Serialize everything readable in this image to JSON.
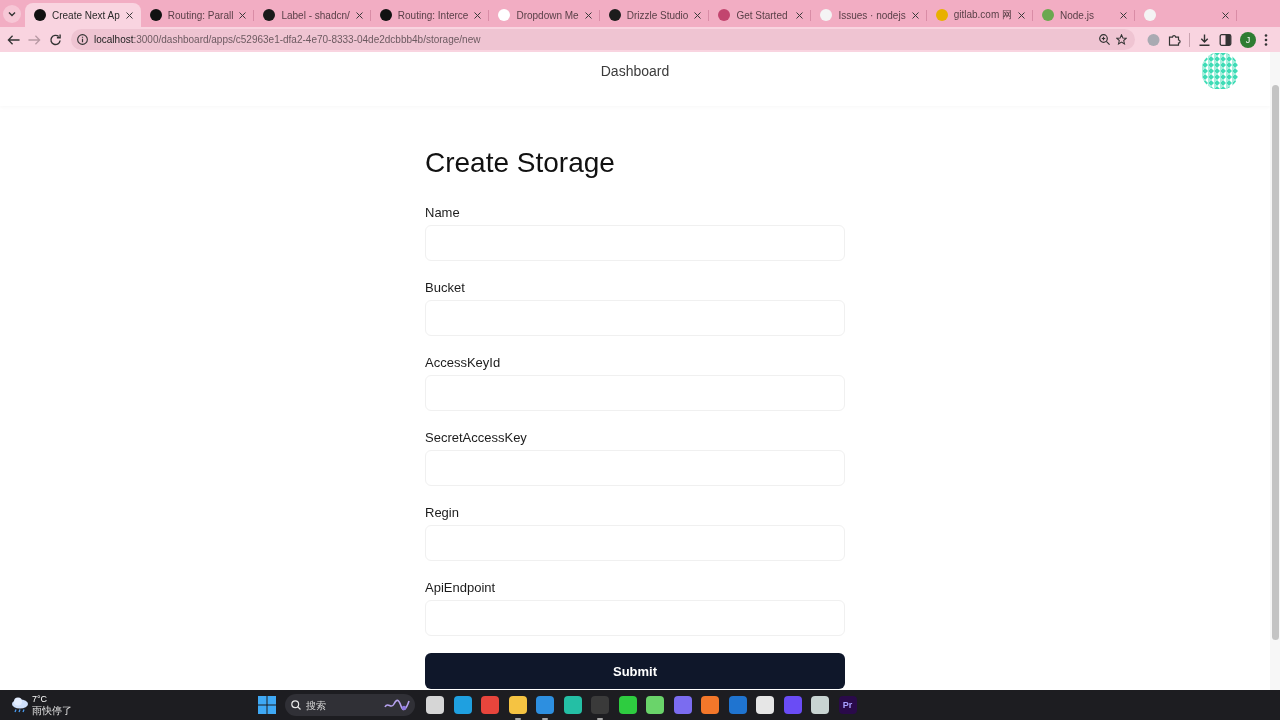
{
  "browser": {
    "tabs": [
      {
        "title": "Create Next Ap",
        "selected": true,
        "color": "#111111"
      },
      {
        "title": "Routing: Parall",
        "selected": false,
        "color": "#111111"
      },
      {
        "title": "Label - shadcn/",
        "selected": false,
        "color": "#1a1a1a"
      },
      {
        "title": "Routing: Interce",
        "selected": false,
        "color": "#111111"
      },
      {
        "title": "Dropdown Me",
        "selected": false,
        "color": "#ffffff"
      },
      {
        "title": "Drizzle Studio",
        "selected": false,
        "color": "#1c1c1c"
      },
      {
        "title": "Get Started",
        "selected": false,
        "color": "#c2456f"
      },
      {
        "title": "Issues · nodejs",
        "selected": false,
        "color": "#f4f4f4"
      },
      {
        "title": "gitlab.com 网",
        "selected": false,
        "color": "#e8b000"
      },
      {
        "title": "Node.js",
        "selected": false,
        "color": "#6aa84f"
      },
      {
        "selected": false,
        "color": "#f4f4f4"
      }
    ],
    "toolbar": {
      "forward_disabled": true,
      "url": {
        "host": "localhost",
        "path": ":3000/dashboard/apps/c52963e1-dfa2-4e70-8333-04de2dcbbb4b/storage/new"
      },
      "profile_initial": "J"
    }
  },
  "page": {
    "header_title": "Dashboard",
    "title": "Create Storage",
    "fields": [
      {
        "label": "Name"
      },
      {
        "label": "Bucket"
      },
      {
        "label": "AccessKeyId"
      },
      {
        "label": "SecretAccessKey"
      },
      {
        "label": "Regin"
      },
      {
        "label": "ApiEndpoint"
      }
    ],
    "submit": "Submit"
  },
  "taskbar": {
    "weather": {
      "temperature": "7°C",
      "condition": "雨快停了"
    },
    "search": {
      "placeholder": "搜索"
    },
    "apps": [
      {
        "color": "#d6d6d6",
        "running": false
      },
      {
        "color": "#1fa0e0",
        "running": false
      },
      {
        "color": "#e8453c",
        "running": false
      },
      {
        "color": "#f5c342",
        "running": true
      },
      {
        "color": "#2d8fe0",
        "running": true
      },
      {
        "color": "#24bfa5",
        "running": false
      },
      {
        "color": "#3a3a3a",
        "running": true
      },
      {
        "color": "#2ecc40",
        "running": false
      },
      {
        "color": "#6ad46a",
        "running": false
      },
      {
        "color": "#7b6cf0",
        "running": false
      },
      {
        "color": "#f3772a",
        "running": false
      },
      {
        "color": "#1f74d0",
        "running": false
      },
      {
        "color": "#e6e6e6",
        "running": false
      },
      {
        "color": "#6a4cf5",
        "running": false
      },
      {
        "color": "#c9d4d2",
        "running": false
      },
      {
        "color": "#2a0a4a",
        "running": false,
        "label": "Pr"
      }
    ]
  }
}
